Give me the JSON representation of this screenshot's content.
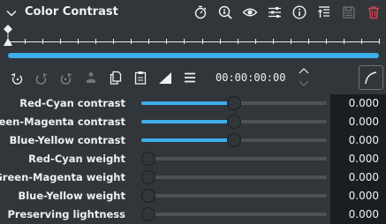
{
  "header": {
    "title": "Color Contrast",
    "icons": [
      "timer-icon",
      "zoom-icon",
      "eye-icon",
      "settings-sliders-icon",
      "info-icon",
      "move-up-icon",
      "save-disabled-icon",
      "delete-icon"
    ]
  },
  "toolbar": {
    "timecode": "00:00:00:00"
  },
  "params": [
    {
      "label": "Red-Cyan contrast",
      "value": "0.000",
      "level": 0.5
    },
    {
      "label": "Green-Magenta contrast",
      "value": "0.000",
      "level": 0.5
    },
    {
      "label": "Blue-Yellow contrast",
      "value": "0.000",
      "level": 0.5
    },
    {
      "label": "Red-Cyan weight",
      "value": "0.000",
      "level": 0
    },
    {
      "label": "Green-Magenta weight",
      "value": "0.000",
      "level": 0
    },
    {
      "label": "Blue-Yellow weight",
      "value": "0.000",
      "level": 0
    },
    {
      "label": "Preserving lightness",
      "value": "0.000",
      "level": 0
    }
  ],
  "colors": {
    "accent": "#3daee9",
    "delete": "#da4453",
    "background": "#31363b",
    "field": "#1b1e20"
  }
}
